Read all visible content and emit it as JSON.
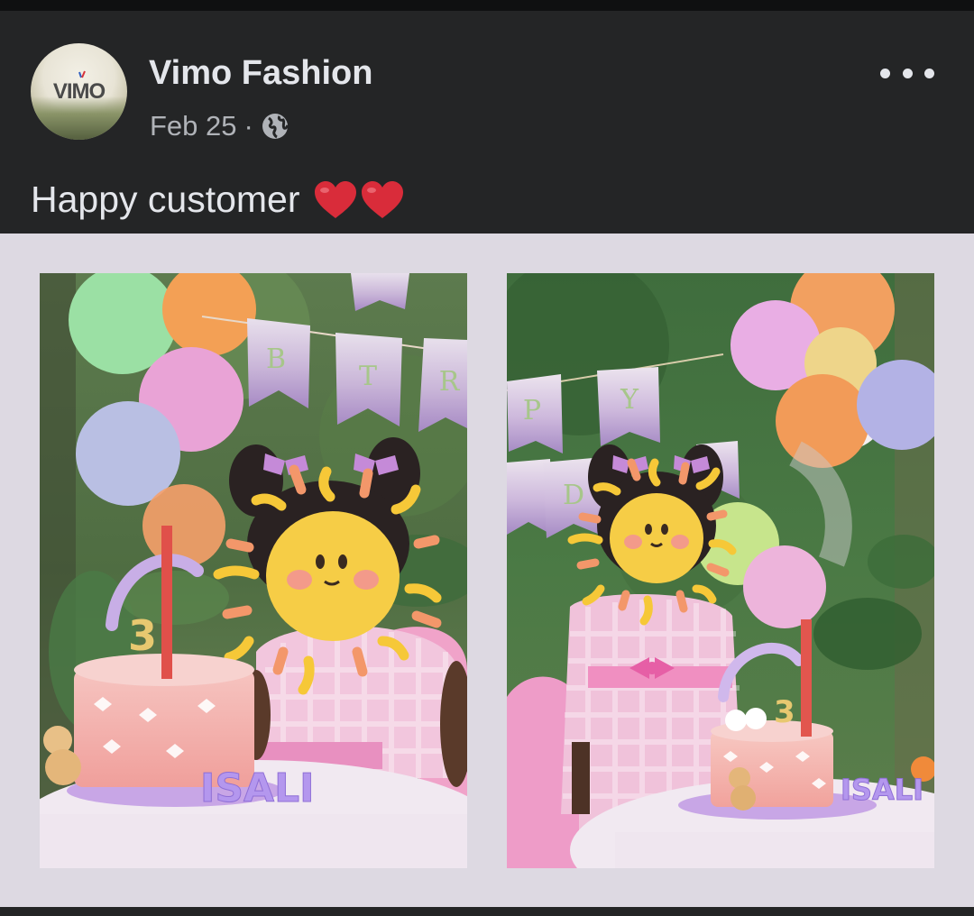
{
  "post": {
    "page_name": "Vimo Fashion",
    "date": "Feb 25",
    "separator": "·",
    "privacy_icon": "globe-icon",
    "more_icon": "more-options-icon",
    "caption": "Happy customer",
    "caption_emoji": [
      "red-heart-emoji",
      "red-heart-emoji"
    ]
  },
  "avatar": {
    "logo_text": "VIMO"
  },
  "photos": [
    {
      "name": "photo-1",
      "banner_letters": [
        "B",
        "T",
        "R"
      ],
      "cake_label": "ISALI",
      "candle": "3"
    },
    {
      "name": "photo-2",
      "banner_letters": [
        "P",
        "Y",
        "D"
      ],
      "cake_label": "ISALI",
      "candle": "3"
    }
  ],
  "colors": {
    "header_bg": "#242526",
    "gallery_bg": "#ddd9e2",
    "primary_text": "#e4e6eb",
    "secondary_text": "#b0b3b8",
    "heart": "#d92c3a"
  }
}
